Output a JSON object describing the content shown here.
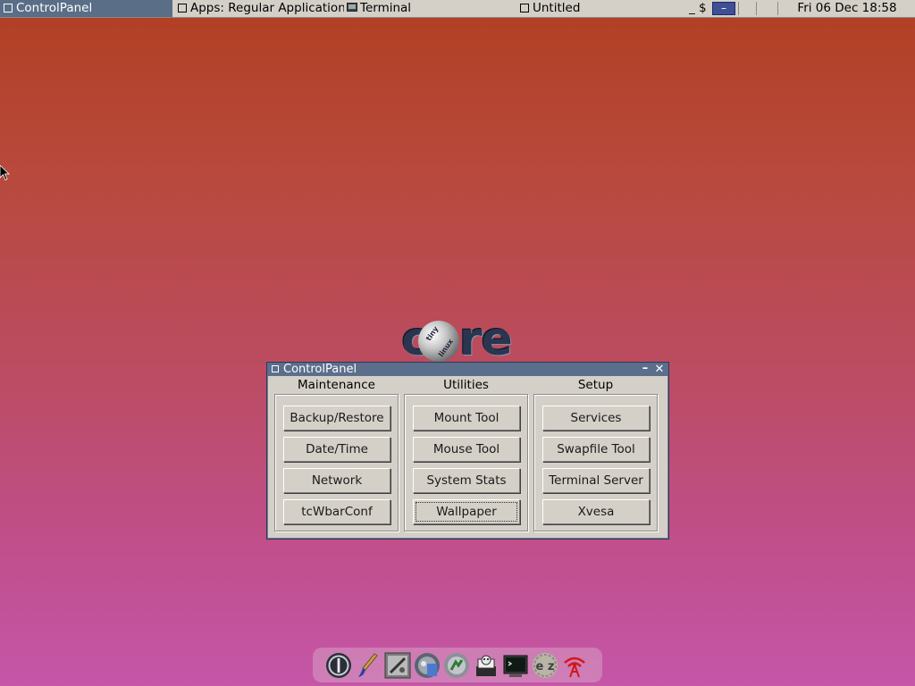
{
  "taskbar": {
    "active_window": "ControlPanel",
    "window_apps": "Apps: Regular Applications",
    "window_terminal": "Terminal",
    "window_untitled": "Untitled",
    "tray_symbols": "_ $",
    "clock": "Fri 06 Dec 18:58"
  },
  "logo": {
    "text": "core",
    "word_tiny": "tiny",
    "word_linux": "linux"
  },
  "control_panel": {
    "title": "ControlPanel",
    "minimize_glyph": "–",
    "close_glyph": "✕",
    "columns": [
      {
        "heading": "Maintenance",
        "buttons": [
          "Backup/Restore",
          "Date/Time",
          "Network",
          "tcWbarConf"
        ]
      },
      {
        "heading": "Utilities",
        "buttons": [
          "Mount Tool",
          "Mouse Tool",
          "System Stats",
          "Wallpaper"
        ]
      },
      {
        "heading": "Setup",
        "buttons": [
          "Services",
          "Swapfile Tool",
          "Terminal Server",
          "Xvesa"
        ]
      }
    ],
    "focused_button": "Wallpaper"
  },
  "dock": {
    "icons": [
      "power-icon",
      "paintbrush-icon",
      "control-panel-icon",
      "mount-icon",
      "apps-icon",
      "editor-icon",
      "terminal-icon",
      "ezremaster-icon",
      "wifi-icon"
    ],
    "ezremaster_label": "e z"
  },
  "colors": {
    "desktop_top": "#b13f23",
    "desktop_bottom": "#c556a8",
    "titlebar": "#5b6e8c",
    "panel_bg": "#d4d0c8",
    "taskbar_bg": "#d4d0c8"
  }
}
